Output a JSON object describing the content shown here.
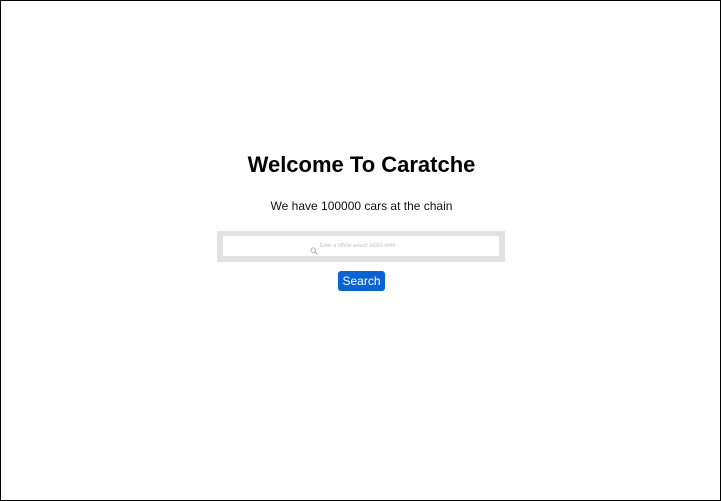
{
  "page": {
    "title": "Welcome To Caratche",
    "subtitle": "We have 100000 cars at the chain"
  },
  "search": {
    "placeholder": "Enter a VIN to search XXXX-####",
    "value": "",
    "icon": "search-icon",
    "button_label": "Search"
  },
  "colors": {
    "accent": "#0b63d3",
    "search_border": "#e2e2e2",
    "background": "#ffffff"
  }
}
